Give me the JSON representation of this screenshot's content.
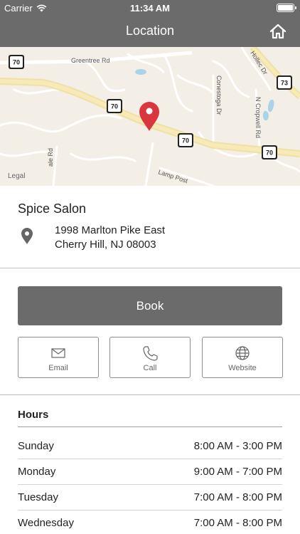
{
  "status_bar": {
    "carrier": "Carrier",
    "time": "11:34 AM",
    "battery_level": 1.0
  },
  "nav": {
    "title": "Location",
    "home_icon": "home-icon"
  },
  "map": {
    "road_labels": [
      "Greentree Rd",
      "Hollec Dr",
      "Conestoga Dr",
      "N Cropwell Rd",
      "Lamp Post",
      "ale Rd"
    ],
    "route_shields": [
      "70",
      "70",
      "70",
      "70",
      "73"
    ],
    "legal_label": "Legal",
    "pin_color": "#d9363e"
  },
  "business": {
    "name": "Spice Salon",
    "address_line1": "1998 Marlton Pike East",
    "address_line2": "Cherry Hill, NJ 08003"
  },
  "actions": {
    "book_label": "Book",
    "email_label": "Email",
    "call_label": "Call",
    "website_label": "Website"
  },
  "hours": {
    "heading": "Hours",
    "rows": [
      {
        "day": "Sunday",
        "time": "8:00 AM - 3:00 PM"
      },
      {
        "day": "Monday",
        "time": "9:00 AM - 7:00 PM"
      },
      {
        "day": "Tuesday",
        "time": "7:00 AM - 8:00 PM"
      },
      {
        "day": "Wednesday",
        "time": "7:00 AM - 8:00 PM"
      }
    ]
  },
  "colors": {
    "header": "#6b6b6b",
    "button": "#6b6b6b",
    "map_background": "#f3eee6",
    "map_highway": "#f7e7a6"
  }
}
